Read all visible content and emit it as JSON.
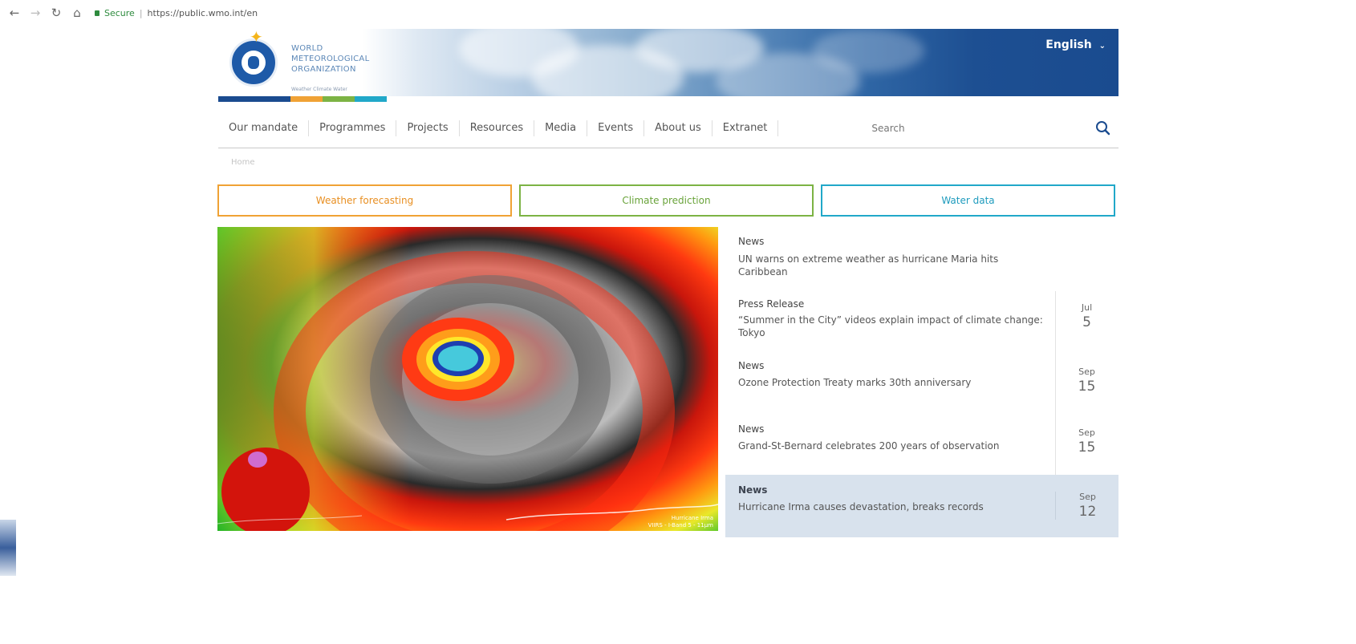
{
  "browser": {
    "secure_label": "Secure",
    "url": "https://public.wmo.int/en"
  },
  "header": {
    "org_line1": "WORLD",
    "org_line2": "METEOROLOGICAL",
    "org_line3": "ORGANIZATION",
    "tagline": "Weather Climate Water",
    "language": "English"
  },
  "colors": {
    "brand_blue": "#1a4b8f",
    "weather": "#f0a235",
    "climate": "#7cb344",
    "water": "#21a8c9",
    "highlight_bg": "#d8e2ed"
  },
  "menu": {
    "items": [
      "Our mandate",
      "Programmes",
      "Projects",
      "Resources",
      "Media",
      "Events",
      "About us",
      "Extranet"
    ],
    "search_placeholder": "Search"
  },
  "breadcrumb": "Home",
  "categories": [
    "Weather forecasting",
    "Climate prediction",
    "Water data"
  ],
  "hero": {
    "caption_line1": "Hurricane Irma",
    "caption_line2": "VIIRS - I-Band 5 - 11µm"
  },
  "news": [
    {
      "type": "News",
      "title": "UN warns on extreme weather as hurricane Maria hits Caribbean",
      "month": "",
      "day": ""
    },
    {
      "type": "Press Release",
      "title": "“Summer in the City” videos explain impact of climate change: Tokyo",
      "month": "Jul",
      "day": "5"
    },
    {
      "type": "News",
      "title": "Ozone Protection Treaty marks 30th anniversary",
      "month": "Sep",
      "day": "15"
    },
    {
      "type": "News",
      "title": "Grand-St-Bernard celebrates 200 years of observation",
      "month": "Sep",
      "day": "15"
    },
    {
      "type": "News",
      "title": "Hurricane Irma causes devastation, breaks records",
      "month": "Sep",
      "day": "12"
    }
  ]
}
